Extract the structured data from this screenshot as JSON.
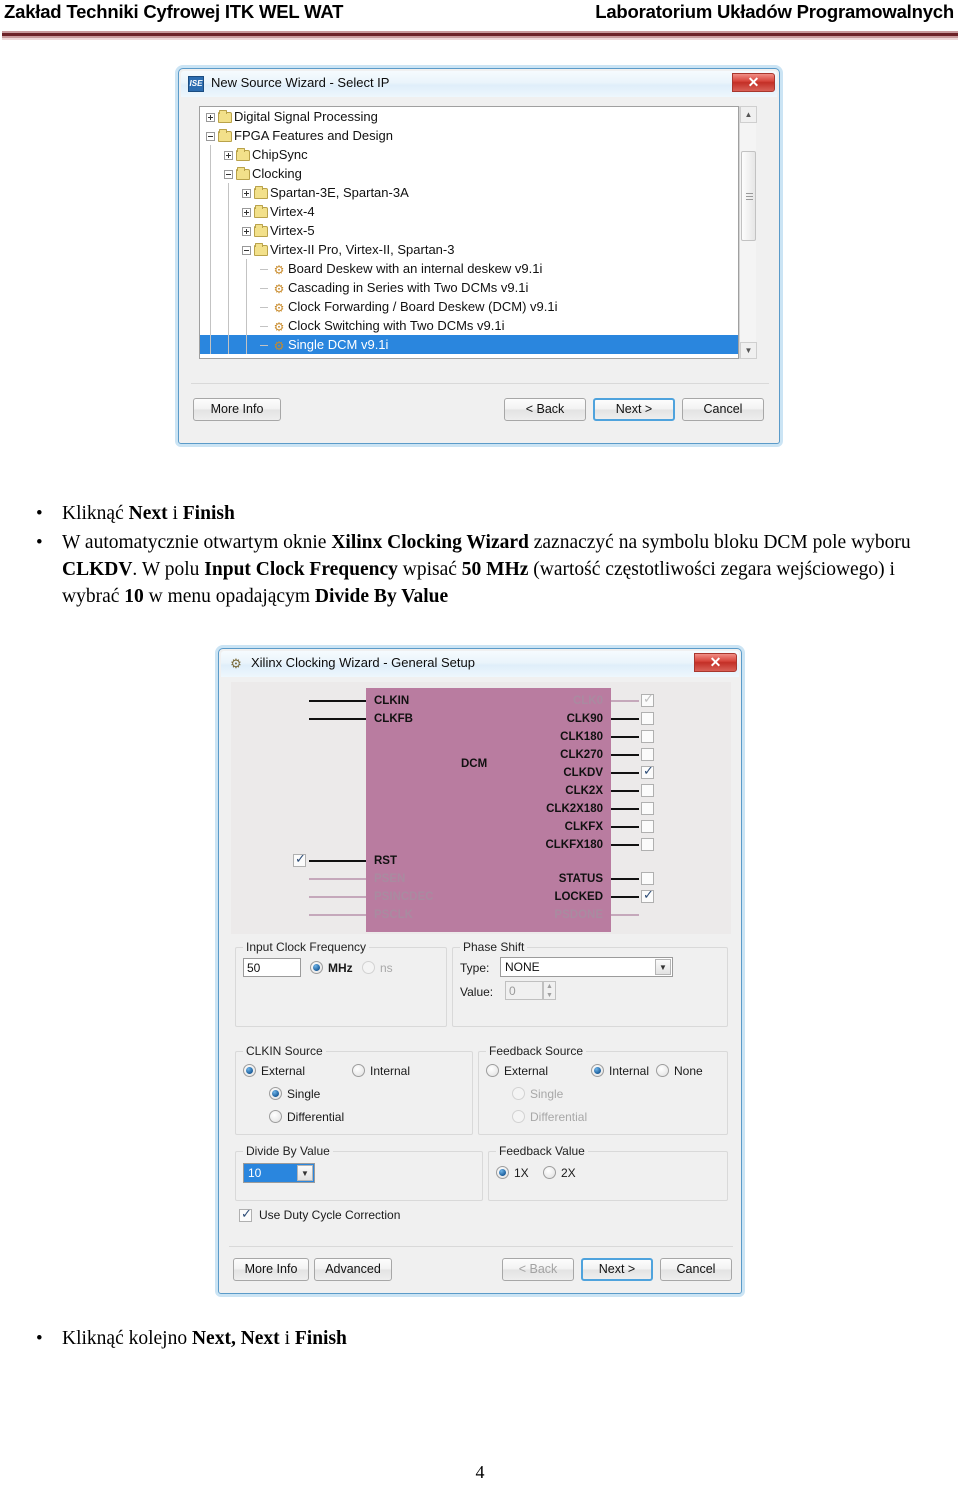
{
  "header": {
    "left": "Zakład Techniki Cyfrowej ITK WEL WAT",
    "right": "Laboratorium Układów Programowalnych"
  },
  "dialog_select_ip": {
    "title": "New Source Wizard - Select IP",
    "icon": "ise-logo-icon",
    "close_label": "✕",
    "tree": [
      {
        "label": "Digital Signal Processing",
        "depth": 0,
        "type": "folder",
        "expander": "plus",
        "selected": false
      },
      {
        "label": "FPGA Features and Design",
        "depth": 0,
        "type": "folder",
        "expander": "minus",
        "selected": false
      },
      {
        "label": "ChipSync",
        "depth": 1,
        "type": "folder",
        "expander": "plus",
        "selected": false
      },
      {
        "label": "Clocking",
        "depth": 1,
        "type": "folder",
        "expander": "minus",
        "selected": false
      },
      {
        "label": "Spartan-3E, Spartan-3A",
        "depth": 2,
        "type": "folder",
        "expander": "plus",
        "selected": false
      },
      {
        "label": "Virtex-4",
        "depth": 2,
        "type": "folder",
        "expander": "plus",
        "selected": false
      },
      {
        "label": "Virtex-5",
        "depth": 2,
        "type": "folder",
        "expander": "plus",
        "selected": false
      },
      {
        "label": "Virtex-II Pro, Virtex-II, Spartan-3",
        "depth": 2,
        "type": "folder",
        "expander": "minus",
        "selected": false
      },
      {
        "label": "Board Deskew with an internal deskew v9.1i",
        "depth": 3,
        "type": "ip",
        "expander": "none",
        "selected": false
      },
      {
        "label": "Cascading in Series with Two DCMs v9.1i",
        "depth": 3,
        "type": "ip",
        "expander": "none",
        "selected": false
      },
      {
        "label": "Clock Forwarding / Board Deskew (DCM) v9.1i",
        "depth": 3,
        "type": "ip",
        "expander": "none",
        "selected": false
      },
      {
        "label": "Clock Switching with Two DCMs v9.1i",
        "depth": 3,
        "type": "ip",
        "expander": "none",
        "selected": false
      },
      {
        "label": "Single DCM v9.1i",
        "depth": 3,
        "type": "ip",
        "expander": "none",
        "selected": true
      }
    ],
    "buttons": {
      "more_info": "More Info",
      "back": "< Back",
      "next": "Next >",
      "cancel": "Cancel"
    },
    "scroll_up": "▲",
    "scroll_down": "▼"
  },
  "text_block_1": {
    "b1_pre": "Kliknąć ",
    "b1_b1": "Next",
    "b1_mid": " i ",
    "b1_b2": "Finish",
    "b2_p1": "W automatycznie otwartym oknie ",
    "b2_b1": "Xilinx Clocking Wizard",
    "b2_p2": " zaznaczyć na symbolu bloku DCM pole wyboru ",
    "b2_b2": "CLKDV",
    "b2_p3": ". W polu ",
    "b2_b3": "Input Clock Frequency",
    "b2_p4": " wpisać ",
    "b2_b4": "50 MHz",
    "b2_p5": " (wartość częstotliwości zegara wejściowego) i wybrać ",
    "b2_b5": "10",
    "b2_p6": " w menu opadającym ",
    "b2_b6": "Divide By Value"
  },
  "dialog_clocking_wizard": {
    "title": "Xilinx Clocking Wizard - General Setup",
    "icon": "gear-icon",
    "close_label": "✕",
    "diagram": {
      "block_label": "DCM",
      "block_color": "#b97ca0",
      "inputs": [
        {
          "name": "CLKIN",
          "enabled": true,
          "has_checkbox": false,
          "checked": false
        },
        {
          "name": "CLKFB",
          "enabled": true,
          "has_checkbox": false,
          "checked": false
        },
        {
          "name": "RST",
          "enabled": true,
          "has_checkbox": true,
          "checked": true
        },
        {
          "name": "PSEN",
          "enabled": false,
          "has_checkbox": false,
          "checked": false
        },
        {
          "name": "PSINCDEC",
          "enabled": false,
          "has_checkbox": false,
          "checked": false
        },
        {
          "name": "PSCLK",
          "enabled": false,
          "has_checkbox": false,
          "checked": false
        }
      ],
      "outputs": [
        {
          "name": "CLK0",
          "enabled": false,
          "has_checkbox": true,
          "checked": true,
          "check_style": "dim"
        },
        {
          "name": "CLK90",
          "enabled": true,
          "has_checkbox": true,
          "checked": false,
          "check_style": ""
        },
        {
          "name": "CLK180",
          "enabled": true,
          "has_checkbox": true,
          "checked": false,
          "check_style": ""
        },
        {
          "name": "CLK270",
          "enabled": true,
          "has_checkbox": true,
          "checked": false,
          "check_style": ""
        },
        {
          "name": "CLKDV",
          "enabled": true,
          "has_checkbox": true,
          "checked": true,
          "check_style": ""
        },
        {
          "name": "CLK2X",
          "enabled": true,
          "has_checkbox": true,
          "checked": false,
          "check_style": ""
        },
        {
          "name": "CLK2X180",
          "enabled": true,
          "has_checkbox": true,
          "checked": false,
          "check_style": ""
        },
        {
          "name": "CLKFX",
          "enabled": true,
          "has_checkbox": true,
          "checked": false,
          "check_style": ""
        },
        {
          "name": "CLKFX180",
          "enabled": true,
          "has_checkbox": true,
          "checked": false,
          "check_style": ""
        },
        {
          "name": "STATUS",
          "enabled": true,
          "has_checkbox": true,
          "checked": false,
          "check_style": ""
        },
        {
          "name": "LOCKED",
          "enabled": true,
          "has_checkbox": true,
          "checked": true,
          "check_style": ""
        },
        {
          "name": "PSDONE",
          "enabled": false,
          "has_checkbox": false,
          "checked": false,
          "check_style": ""
        }
      ],
      "tick_glyph": "✓"
    },
    "input_clock_frequency": {
      "group_label": "Input Clock Frequency",
      "value": "50",
      "unit_mhz": "MHz",
      "unit_ns": "ns",
      "unit_selected": "MHz"
    },
    "phase_shift": {
      "group_label": "Phase Shift",
      "type_label": "Type:",
      "type_value": "NONE",
      "value_label": "Value:",
      "value": "0",
      "arrow": "▼"
    },
    "clkin_source": {
      "group_label": "CLKIN Source",
      "external": "External",
      "internal": "Internal",
      "single": "Single",
      "differential": "Differential",
      "selected_source": "External",
      "selected_mode": "Single"
    },
    "feedback_source": {
      "group_label": "Feedback Source",
      "external": "External",
      "internal": "Internal",
      "none": "None",
      "single": "Single",
      "differential": "Differential",
      "selected_source": "Internal"
    },
    "divide_by_value": {
      "group_label": "Divide By Value",
      "value": "10",
      "arrow": "▼"
    },
    "feedback_value": {
      "group_label": "Feedback Value",
      "opt_1x": "1X",
      "opt_2x": "2X",
      "selected": "1X"
    },
    "duty_cycle": {
      "label": "Use Duty Cycle Correction",
      "checked": true
    },
    "buttons": {
      "more_info": "More Info",
      "advanced": "Advanced",
      "back": "< Back",
      "next": "Next >",
      "cancel": "Cancel",
      "back_disabled": true
    }
  },
  "text_block_2": {
    "pre": "Kliknąć kolejno ",
    "b1": "Next, Next",
    "mid": " i ",
    "b2": "Finish"
  },
  "page_number": "4"
}
